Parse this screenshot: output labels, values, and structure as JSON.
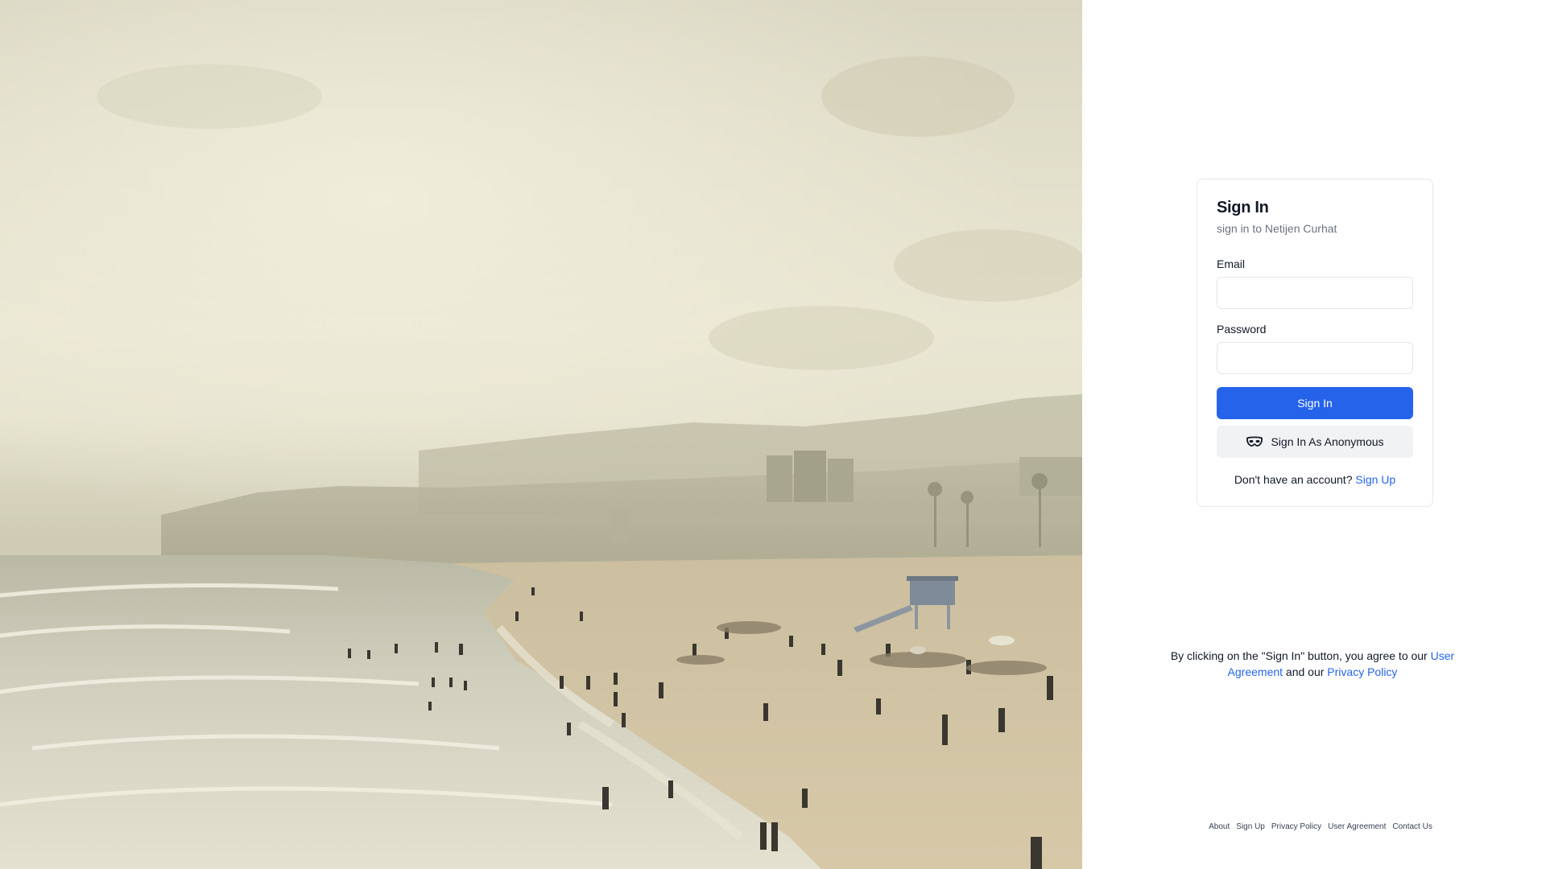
{
  "signin": {
    "title": "Sign In",
    "subtitle": "sign in to Netijen Curhat",
    "email_label": "Email",
    "email_value": "",
    "password_label": "Password",
    "password_value": "",
    "submit_label": "Sign In",
    "anonymous_label": "Sign In As Anonymous",
    "anonymous_icon": "mask-icon",
    "no_account_text": "Don't have an account?",
    "signup_link": "Sign Up"
  },
  "agreement": {
    "prefix": "By clicking on the \"Sign In\" button, you agree to our",
    "user_agreement_link": "User Agreement",
    "middle": "and our",
    "privacy_policy_link": "Privacy Policy"
  },
  "footer": {
    "links": [
      "About",
      "Sign Up",
      "Privacy Policy",
      "User Agreement",
      "Contact Us"
    ]
  },
  "colors": {
    "primary": "#2563eb",
    "secondary_button_bg": "#f1f2f4",
    "border": "#e5e7eb",
    "muted_text": "#6b7280"
  }
}
